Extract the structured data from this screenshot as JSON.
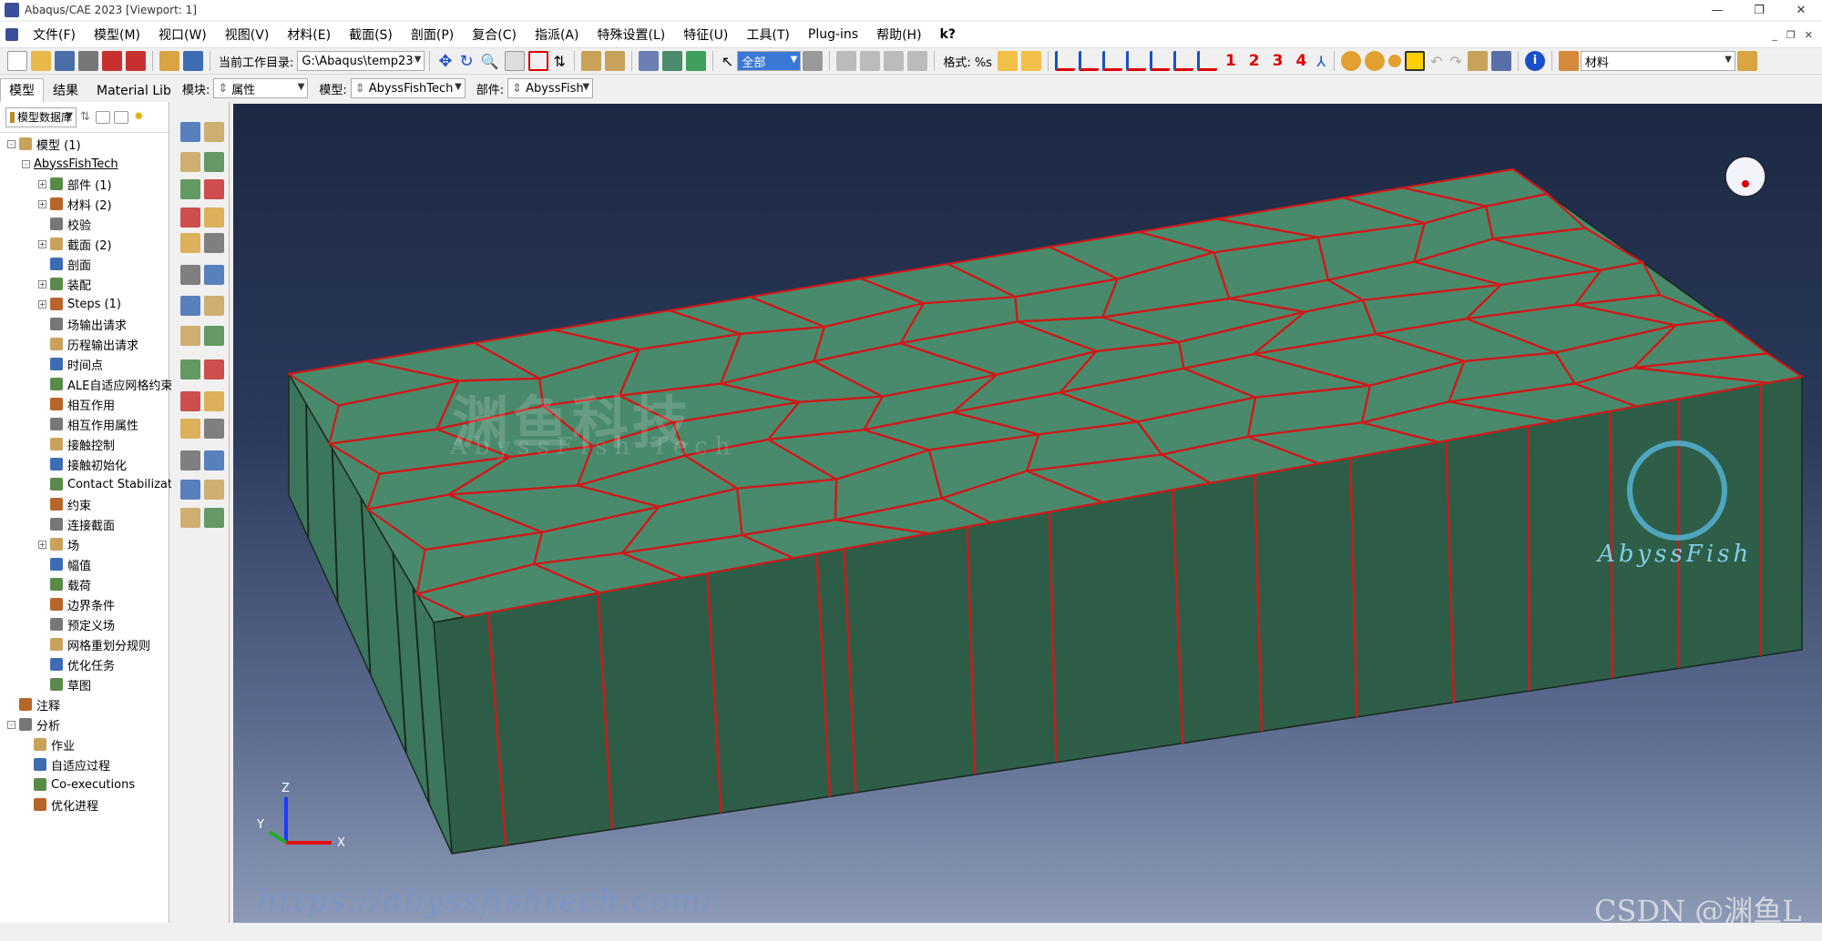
{
  "window": {
    "title": "Abaqus/CAE 2023 [Viewport: 1]",
    "controls": [
      "—",
      "❐",
      "✕"
    ],
    "mdi_controls": [
      "_",
      "❐",
      "✕"
    ]
  },
  "menu": [
    "文件(F)",
    "模型(M)",
    "视口(W)",
    "视图(V)",
    "材料(E)",
    "截面(S)",
    "剖面(P)",
    "复合(C)",
    "指派(A)",
    "特殊设置(L)",
    "特征(U)",
    "工具(T)",
    "Plug-ins",
    "帮助(H)",
    "k?"
  ],
  "toolbar1": {
    "workdir_label": "当前工作目录:",
    "workdir_value": "G:\\Abaqus\\temp23",
    "select_value": "全部",
    "format_label": "格式: %s",
    "view_numbers": [
      "1",
      "2",
      "3",
      "4"
    ],
    "material_label": "材料"
  },
  "tabs": [
    "模型",
    "结果",
    "Material Library"
  ],
  "context": {
    "module_label": "模块:",
    "module_value": "属性",
    "model_label": "模型:",
    "model_value": "AbyssFishTech",
    "part_label": "部件:",
    "part_value": "AbyssFish"
  },
  "tree_tools": {
    "db_label": "模型数据库"
  },
  "tree": [
    {
      "label": "模型 (1)",
      "level": 0,
      "expand": "-",
      "icon": "model-icon"
    },
    {
      "label": "AbyssFishTech",
      "level": 1,
      "expand": "-",
      "link": true
    },
    {
      "label": "部件 (1)",
      "level": 2,
      "expand": "+",
      "icon": "parts-icon"
    },
    {
      "label": "材料 (2)",
      "level": 2,
      "expand": "+",
      "icon": "materials-icon"
    },
    {
      "label": "校验",
      "level": 2,
      "icon": "calibration-icon"
    },
    {
      "label": "截面 (2)",
      "level": 2,
      "expand": "+",
      "icon": "sections-icon"
    },
    {
      "label": "剖面",
      "level": 2,
      "icon": "profiles-icon"
    },
    {
      "label": "装配",
      "level": 2,
      "expand": "+",
      "icon": "assembly-icon"
    },
    {
      "label": "Steps (1)",
      "level": 2,
      "expand": "+",
      "icon": "steps-icon"
    },
    {
      "label": "场输出请求",
      "level": 2,
      "icon": "field-output-icon"
    },
    {
      "label": "历程输出请求",
      "level": 2,
      "icon": "history-output-icon"
    },
    {
      "label": "时间点",
      "level": 2,
      "icon": "time-points-icon"
    },
    {
      "label": "ALE自适应网格约束",
      "level": 2,
      "icon": "ale-icon"
    },
    {
      "label": "相互作用",
      "level": 2,
      "icon": "interaction-icon"
    },
    {
      "label": "相互作用属性",
      "level": 2,
      "icon": "interaction-props-icon"
    },
    {
      "label": "接触控制",
      "level": 2,
      "icon": "contact-control-icon"
    },
    {
      "label": "接触初始化",
      "level": 2,
      "icon": "contact-init-icon"
    },
    {
      "label": "Contact Stabilizations",
      "level": 2,
      "icon": "contact-stab-icon"
    },
    {
      "label": "约束",
      "level": 2,
      "icon": "constraint-icon"
    },
    {
      "label": "连接截面",
      "level": 2,
      "icon": "connector-section-icon"
    },
    {
      "label": "场",
      "level": 2,
      "expand": "+",
      "icon": "field-icon"
    },
    {
      "label": "幅值",
      "level": 2,
      "icon": "amplitude-icon"
    },
    {
      "label": "载荷",
      "level": 2,
      "icon": "load-icon"
    },
    {
      "label": "边界条件",
      "level": 2,
      "icon": "bc-icon"
    },
    {
      "label": "预定义场",
      "level": 2,
      "icon": "predefined-field-icon"
    },
    {
      "label": "网格重划分规则",
      "level": 2,
      "icon": "remesh-icon"
    },
    {
      "label": "优化任务",
      "level": 2,
      "icon": "optimization-icon"
    },
    {
      "label": "草图",
      "level": 2,
      "icon": "sketch-icon"
    },
    {
      "label": "注释",
      "level": 0,
      "icon": "annotation-icon"
    },
    {
      "label": "分析",
      "level": 0,
      "expand": "-",
      "icon": "analysis-icon"
    },
    {
      "label": "作业",
      "level": 1,
      "icon": "job-icon"
    },
    {
      "label": "自适应过程",
      "level": 1,
      "icon": "adaptivity-icon"
    },
    {
      "label": "Co-executions",
      "level": 1,
      "icon": "coexec-icon"
    },
    {
      "label": "优化进程",
      "level": 1,
      "icon": "opt-process-icon"
    }
  ],
  "viewport": {
    "model_color": "#3f7a60",
    "edge_color": "#d01818",
    "watermark_cn": "渊鱼科技",
    "watermark_en": "AbyssFish Tech",
    "logo_text": "AbyssFish",
    "url_watermark": "https://abyssfishtech.com/",
    "csdn_watermark": "CSDN @渊鱼L",
    "triad": {
      "x": "X",
      "y": "Y",
      "z": "Z"
    }
  }
}
